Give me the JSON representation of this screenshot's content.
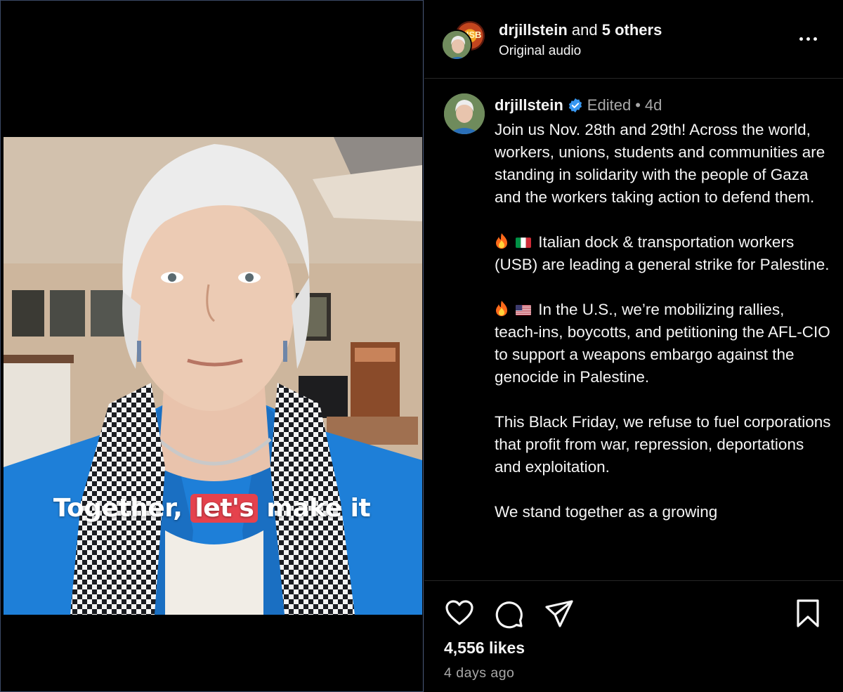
{
  "video": {
    "caption_before": "Together, ",
    "caption_highlight": "let's",
    "caption_after": " make it"
  },
  "header": {
    "username": "drjillstein",
    "and_text": " and ",
    "others": "5 others",
    "audio": "Original audio",
    "collab_badge": "USB"
  },
  "post": {
    "username": "drjillstein",
    "edited": "Edited",
    "dot": "•",
    "time": "4d",
    "paragraphs": {
      "p1": "Join us Nov. 28th and 29th! Across the world, workers, unions, students and communities are standing in solidarity with the people of Gaza and the workers taking action to defend them.",
      "p2": "Italian dock & transportation workers (USB) are leading a general strike for Palestine.",
      "p3": "In the U.S., we’re mobilizing rallies, teach-ins, boycotts, and petitioning the AFL-CIO to support a weapons embargo against the genocide in Palestine.",
      "p4": "This Black Friday, we refuse to fuel corporations that profit from war, repression, deportations and exploitation.",
      "p5": "We stand together as a growing"
    }
  },
  "actions": {
    "like_icon": "heart-icon",
    "comment_icon": "comment-icon",
    "share_icon": "share-icon",
    "save_icon": "bookmark-icon",
    "likes": "4,556 likes",
    "ago": "4 days ago"
  },
  "colors": {
    "background": "#000000",
    "text": "#f5f5f5",
    "muted": "#a8a8a8",
    "verified": "#3897f0",
    "caption_highlight": "#e5424d"
  }
}
